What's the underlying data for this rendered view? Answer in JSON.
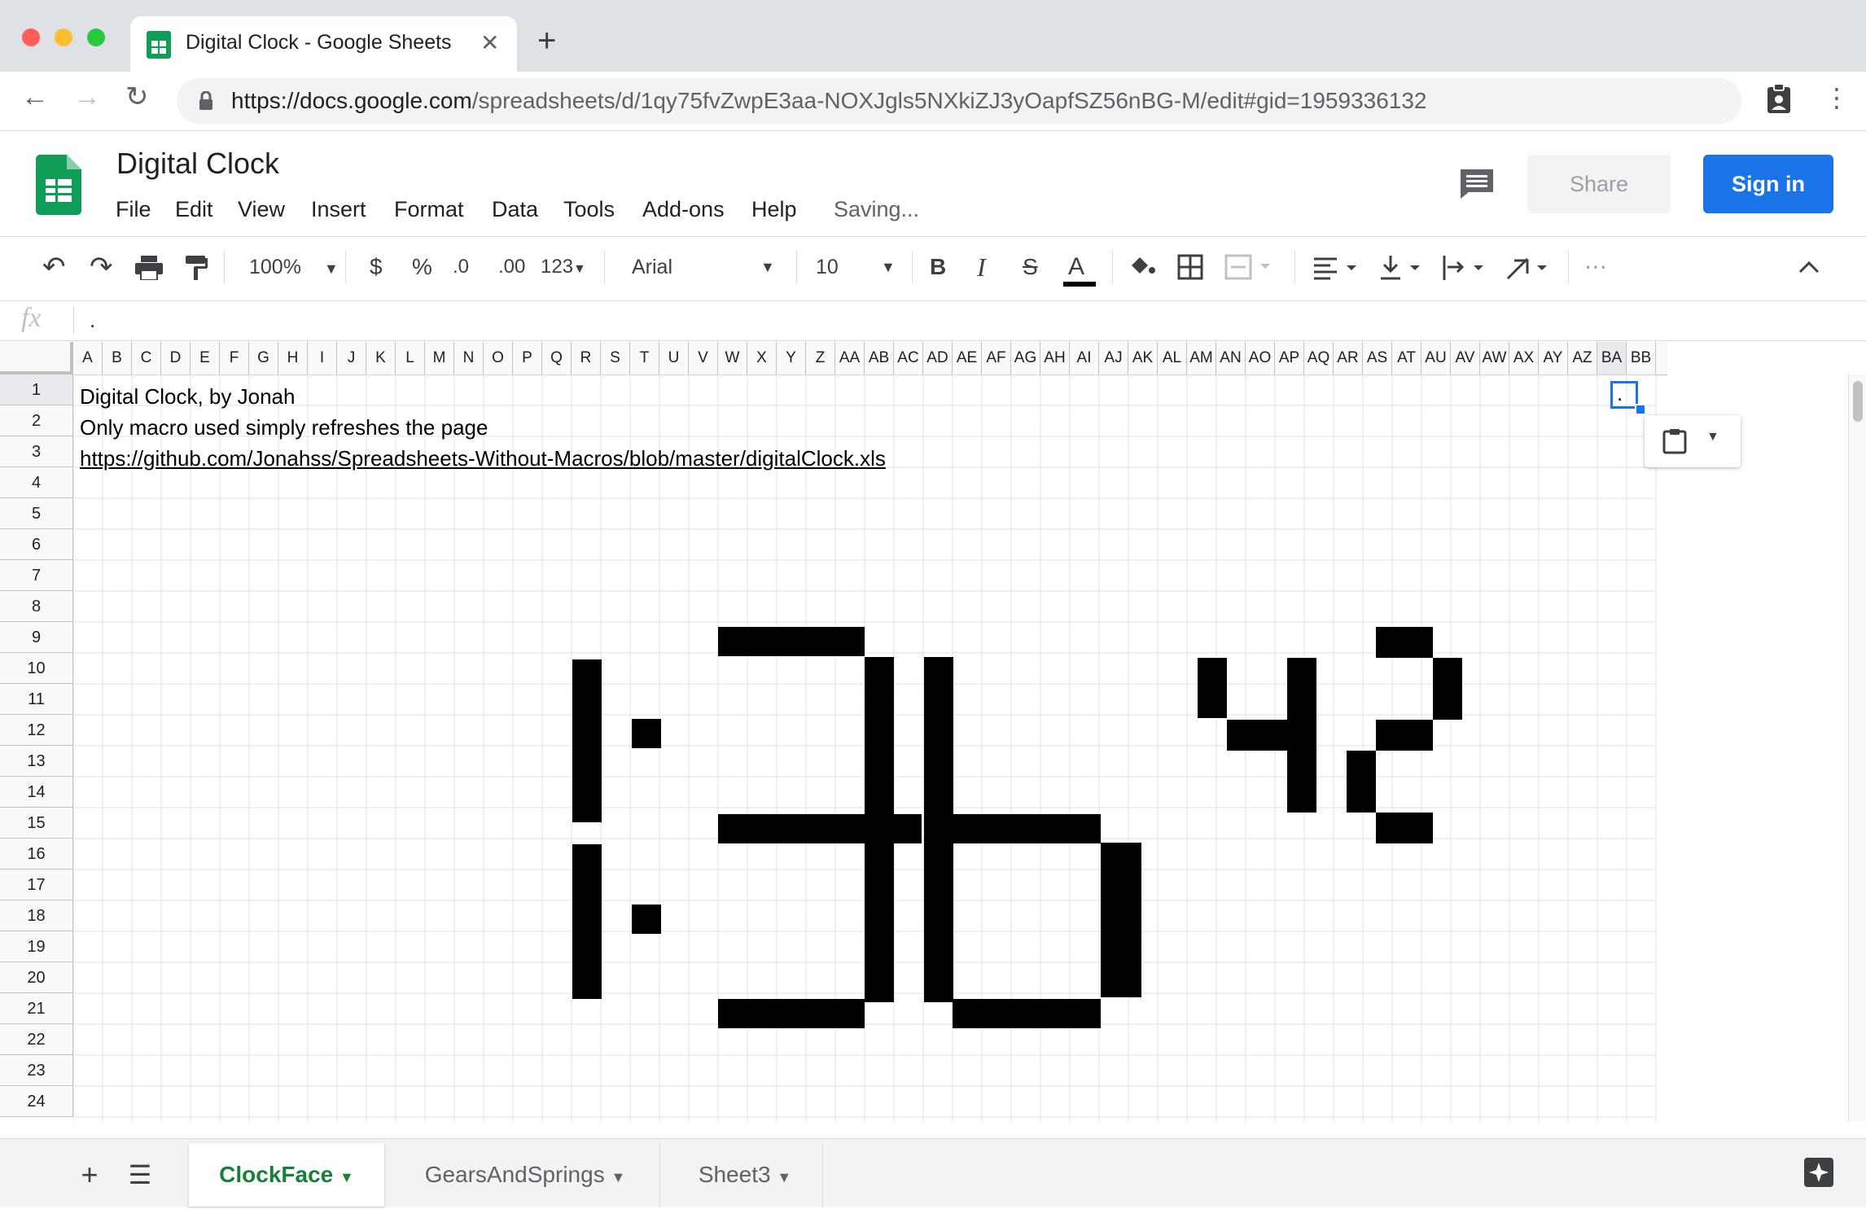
{
  "browser": {
    "tab_title": "Digital Clock - Google Sheets",
    "tab_close": "✕",
    "new_tab": "+",
    "url_host": "https://docs.google.com",
    "url_path": "/spreadsheets/d/1qy75fvZwpE3aa-NOXJgls5NXkiZJ3yOapfSZ56nBG-M/edit#gid=1959336132",
    "traffic_colors": [
      "#ff5f57",
      "#febc2e",
      "#28c840"
    ]
  },
  "sheets": {
    "doc_title": "Digital Clock",
    "menu": [
      "File",
      "Edit",
      "View",
      "Insert",
      "Format",
      "Data",
      "Tools",
      "Add-ons",
      "Help"
    ],
    "status": "Saving...",
    "share_label": "Share",
    "signin_label": "Sign in",
    "accent": "#1a73e8",
    "brand_green": "#0f9d58"
  },
  "toolbar": {
    "zoom": "100%",
    "currency": "$",
    "percent": "%",
    "dec_decrease": ".0",
    "dec_increase": ".00",
    "more_formats": "123",
    "font": "Arial",
    "font_size": "10",
    "bold": "B",
    "italic": "I",
    "strike": "S",
    "text_color": "A",
    "more": "⋯"
  },
  "formula_bar": {
    "fx": "fx",
    "content": "."
  },
  "grid": {
    "columns": [
      "A",
      "B",
      "C",
      "D",
      "E",
      "F",
      "G",
      "H",
      "I",
      "J",
      "K",
      "L",
      "M",
      "N",
      "O",
      "P",
      "Q",
      "R",
      "S",
      "T",
      "U",
      "V",
      "W",
      "X",
      "Y",
      "Z",
      "AA",
      "AB",
      "AC",
      "AD",
      "AE",
      "AF",
      "AG",
      "AH",
      "AI",
      "AJ",
      "AK",
      "AL",
      "AM",
      "AN",
      "AO",
      "AP",
      "AQ",
      "AR",
      "AS",
      "AT",
      "AU",
      "AV",
      "AW",
      "AX",
      "AY",
      "AZ",
      "BA",
      "BB"
    ],
    "rows": [
      "1",
      "2",
      "3",
      "4",
      "5",
      "6",
      "7",
      "8",
      "9",
      "10",
      "11",
      "12",
      "13",
      "14",
      "15",
      "16",
      "17",
      "18",
      "19",
      "20",
      "21",
      "22",
      "23",
      "24"
    ],
    "cell_A1": "Digital Clock, by Jonah",
    "cell_A2": "Only macro used simply refreshes the page",
    "cell_A3": "https://github.com/Jonahss/Spreadsheets-Without-Macros/blob/master/digitalClock.xls",
    "cell_BA1": ".",
    "pixel_color": "#000000"
  },
  "sheet_tabs": {
    "add": "+",
    "list": "☰",
    "tabs": [
      "ClockFace",
      "GearsAndSprings",
      "Sheet3"
    ],
    "active": "ClockFace",
    "active_color": "#188038"
  }
}
